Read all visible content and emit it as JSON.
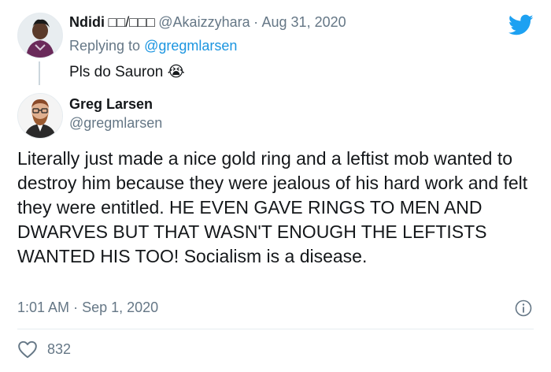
{
  "reply_tweet": {
    "display_name": "Ndidi",
    "name_symbols": "□□/□□□",
    "handle": "@Akaizzyhara",
    "separator": "·",
    "date": "Aug 31, 2020",
    "replying_prefix": "Replying to",
    "replying_handle": "@gregmlarsen",
    "text": "Pls do Sauron",
    "emoji": "😭"
  },
  "main_tweet": {
    "display_name": "Greg Larsen",
    "handle": "@gregmlarsen",
    "text": "Literally just made a nice gold ring and a leftist mob wanted to destroy him because they were jealous of his hard work and felt they were entitled. HE EVEN GAVE RINGS TO MEN AND DWARVES BUT THAT WASN'T ENOUGH THE LEFTISTS WANTED HIS TOO! Socialism is a disease.",
    "time": "1:01 AM",
    "separator": "·",
    "date": "Sep 1, 2020",
    "likes": "832"
  },
  "colors": {
    "twitter_blue": "#1da1f2",
    "link": "#1b95e0",
    "muted": "#657786",
    "like_red": "#e0245e"
  },
  "icons": [
    "twitter-bird-icon",
    "info-icon",
    "heart-icon"
  ]
}
